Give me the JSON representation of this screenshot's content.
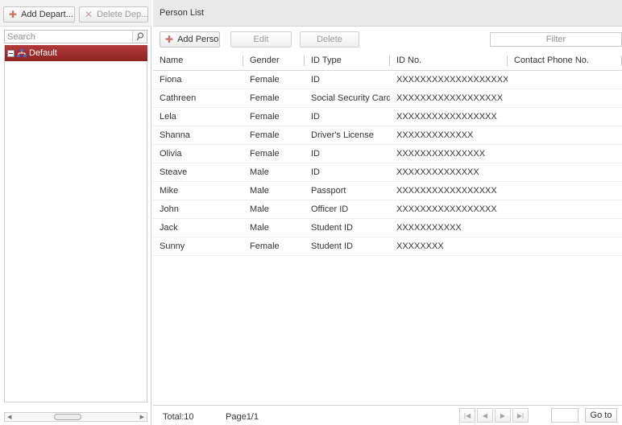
{
  "left_toolbar": {
    "add_department_label": "Add Depart...",
    "delete_department_label": "Delete Dep..."
  },
  "search": {
    "placeholder": "Search",
    "value": ""
  },
  "tree": {
    "selected_node_label": "Default"
  },
  "person_list": {
    "title": "Person List",
    "toolbar": {
      "add_person_label": "Add Person",
      "edit_label": "Edit",
      "delete_label": "Delete",
      "filter_placeholder": "Filter"
    },
    "columns": [
      "Name",
      "Gender",
      "ID Type",
      "ID No.",
      "Contact Phone No."
    ],
    "rows": [
      [
        "Fiona",
        "Female",
        "ID",
        "XXXXXXXXXXXXXXXXXXXXXX",
        ""
      ],
      [
        "Cathreen",
        "Female",
        "Social Security Card",
        "XXXXXXXXXXXXXXXXXX",
        ""
      ],
      [
        "Lela",
        "Female",
        "ID",
        "XXXXXXXXXXXXXXXXX",
        ""
      ],
      [
        "Shanna",
        "Female",
        "Driver's License",
        "XXXXXXXXXXXXX",
        ""
      ],
      [
        "Olivia",
        "Female",
        "ID",
        "XXXXXXXXXXXXXXX",
        ""
      ],
      [
        "Steave",
        "Male",
        "ID",
        "XXXXXXXXXXXXXX",
        ""
      ],
      [
        "Mike",
        "Male",
        "Passport",
        "XXXXXXXXXXXXXXXXX",
        ""
      ],
      [
        "John",
        "Male",
        "Officer ID",
        "XXXXXXXXXXXXXXXXX",
        ""
      ],
      [
        "Jack",
        "Male",
        "Student ID",
        "XXXXXXXXXXX",
        ""
      ],
      [
        "Sunny",
        "Female",
        "Student ID",
        "XXXXXXXX",
        ""
      ]
    ],
    "footer": {
      "total_label": "Total:10",
      "page_label": "Page1/1",
      "page_input_value": "",
      "goto_label": "Go to"
    }
  },
  "icons": {
    "add": "add-icon",
    "delete": "delete-icon",
    "search": "search-icon",
    "tree_node": "organization-icon"
  },
  "colors": {
    "selected_node": "#9e2b2b",
    "header_bg": "#e9e9e9",
    "accent_icon": "#d07060"
  }
}
